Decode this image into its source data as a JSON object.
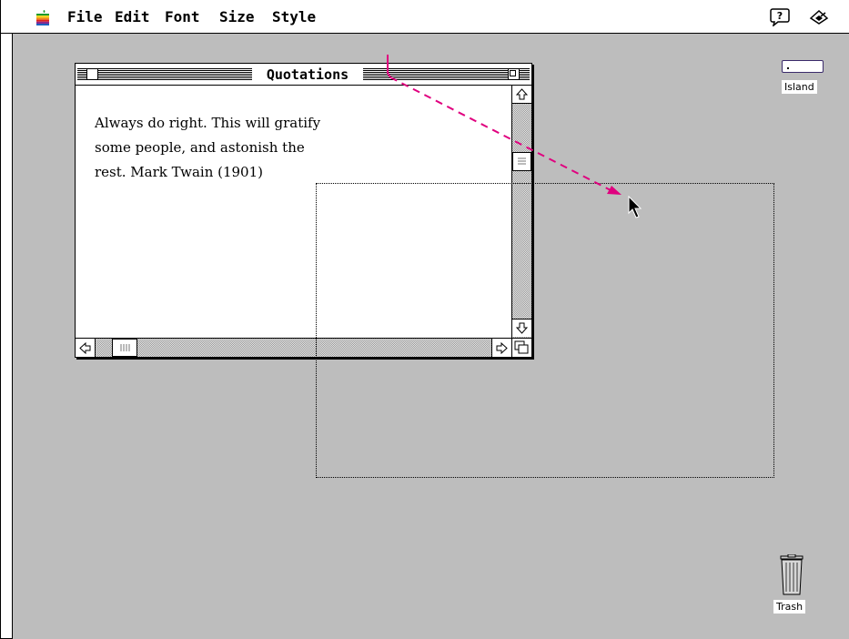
{
  "menubar": {
    "items": [
      "File",
      "Edit",
      "Font",
      "Size",
      "Style"
    ],
    "apple_icon": "apple-rainbow-icon",
    "help_icon": "balloon-help-icon",
    "app_icon": "application-menu-icon"
  },
  "window": {
    "title": "Quotations",
    "text": "Always do right. This will gratify\nsome people, and astonish the\nrest.  Mark Twain (1901)"
  },
  "desktop": {
    "disk_label": "Island",
    "trash_label": "Trash",
    "background": "#bdbdbd"
  },
  "annotation": {
    "arrow_color": "#e0007f"
  }
}
